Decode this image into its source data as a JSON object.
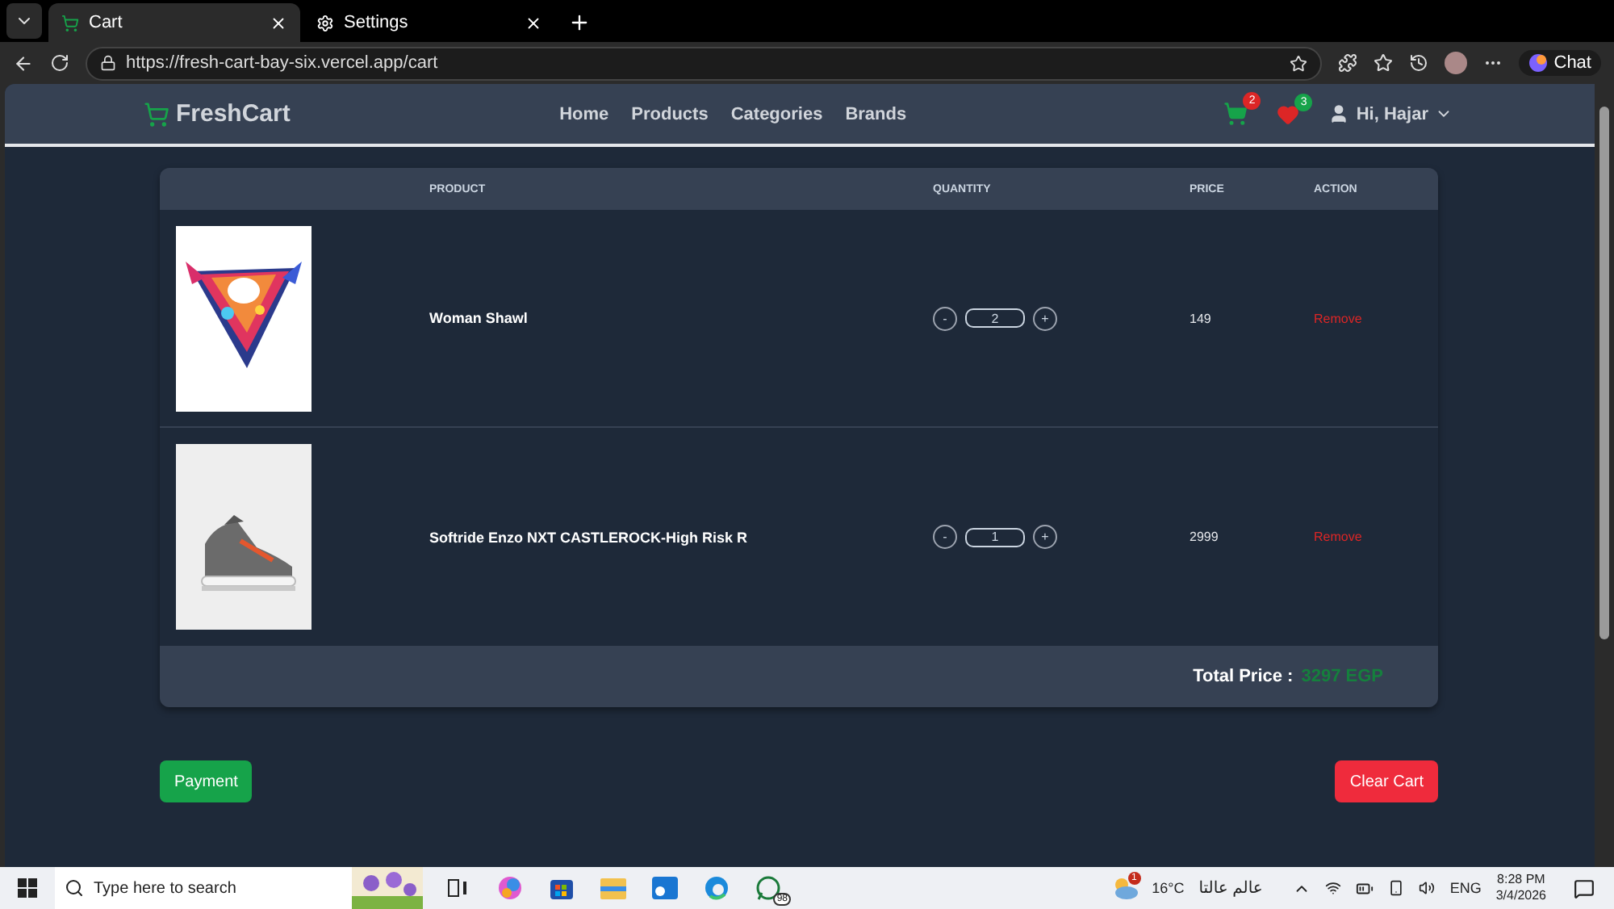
{
  "browser": {
    "tabs": [
      {
        "title": "Cart",
        "selected": true
      },
      {
        "title": "Settings",
        "selected": false
      }
    ],
    "url": "https://fresh-cart-bay-six.vercel.app/cart",
    "chat": "Chat"
  },
  "navbar": {
    "brand": "FreshCart",
    "links": [
      "Home",
      "Products",
      "Categories",
      "Brands"
    ],
    "cart_count": "2",
    "wishlist_count": "3",
    "user": "Hi, Hajar"
  },
  "table": {
    "columns": [
      "PRODUCT",
      "QUANTITY",
      "PRICE",
      "ACTION"
    ],
    "rows": [
      {
        "kind": "shawl",
        "name": "Woman Shawl",
        "decrement": "-",
        "quantity": "2",
        "increment": "+",
        "price": "149",
        "action": "Remove"
      },
      {
        "kind": "shoe",
        "name": "Softride Enzo NXT CASTLEROCK-High Risk R",
        "decrement": "-",
        "quantity": "1",
        "increment": "+",
        "price": "2999",
        "action": "Remove"
      }
    ],
    "total_label": "Total Price :",
    "total": "3297 EGP"
  },
  "buttons": {
    "payment": "Payment",
    "clear": "Clear Cart"
  },
  "taskbar": {
    "search_placeholder": "Type here to search",
    "whatsapp_badge": "98",
    "weather_alert": "1",
    "temperature": "16°C",
    "weather_text": "عالم عالتا",
    "language": "ENG",
    "time": "8:28 PM",
    "date": "3/4/2026"
  }
}
